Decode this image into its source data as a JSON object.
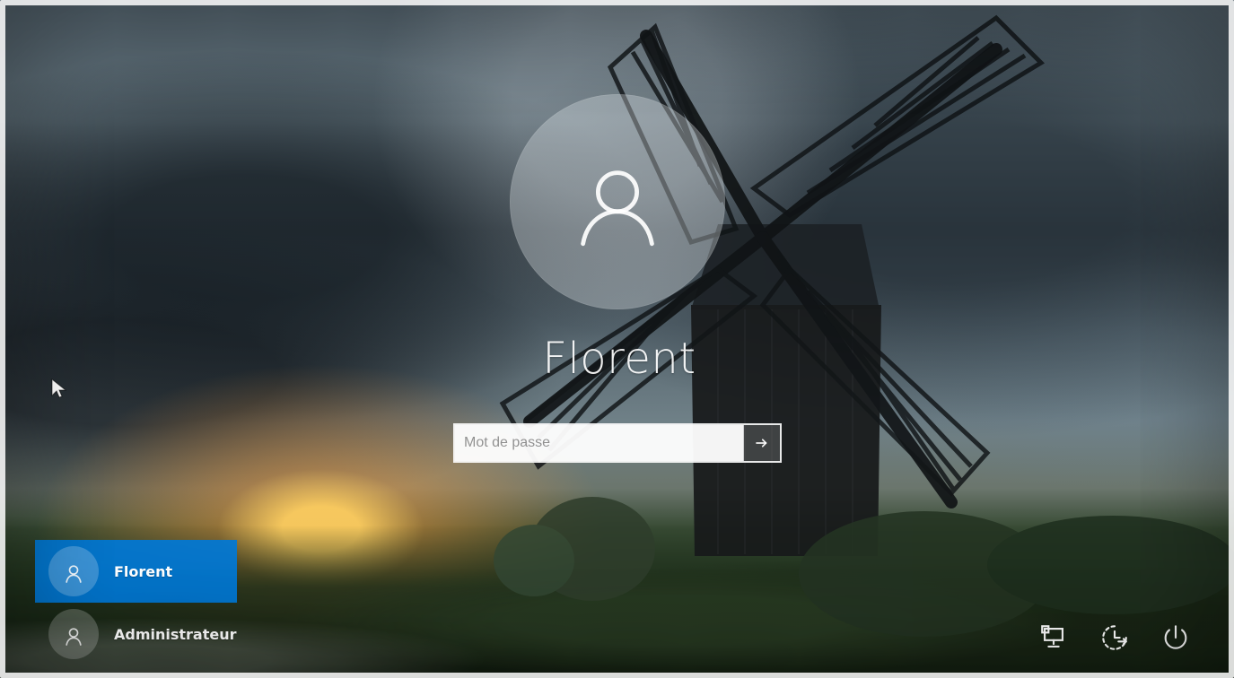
{
  "login": {
    "selected_user_name": "Florent",
    "password_placeholder": "Mot de passe",
    "password_value": ""
  },
  "users": [
    {
      "name": "Florent",
      "selected": true
    },
    {
      "name": "Administrateur",
      "selected": false
    }
  ],
  "icons": {
    "avatar": "user-icon",
    "submit": "arrow-right-icon",
    "network": "network-icon",
    "ease_of_access": "ease-of-access-icon",
    "power": "power-icon",
    "cursor": "mouse-pointer-icon"
  },
  "colors": {
    "selection_blue": "#0078D7"
  }
}
